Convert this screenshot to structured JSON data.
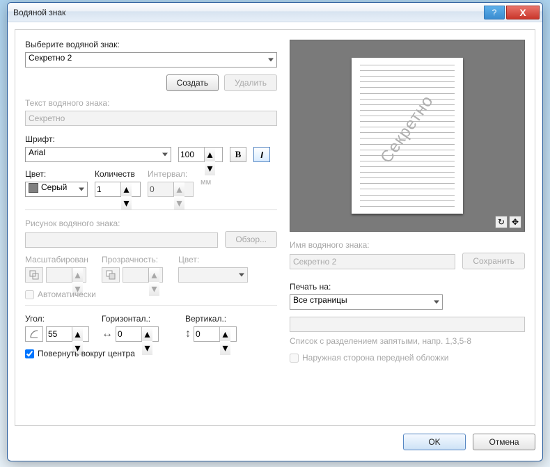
{
  "window": {
    "title": "Водяной знак"
  },
  "select_label": "Выберите водяной знак:",
  "selected_watermark": "Секретно 2",
  "buttons": {
    "create": "Создать",
    "delete": "Удалить",
    "browse": "Обзор...",
    "save": "Сохранить",
    "ok": "OK",
    "cancel": "Отмена"
  },
  "text_section": {
    "label": "Текст водяного знака:",
    "value": "Секретно"
  },
  "font": {
    "label": "Шрифт:",
    "name": "Arial",
    "size": "100",
    "bold_label": "B",
    "italic_label": "I"
  },
  "color": {
    "label": "Цвет:",
    "value": "Серый"
  },
  "count": {
    "label": "Количеств",
    "value": "1"
  },
  "interval": {
    "label": "Интервал:",
    "value": "0",
    "unit": "мм"
  },
  "image_section": {
    "label": "Рисунок водяного знака:",
    "value": ""
  },
  "scale": {
    "label": "Масштабирован"
  },
  "transparency": {
    "label": "Прозрачность:"
  },
  "img_color": {
    "label": "Цвет:"
  },
  "auto_label": "Автоматически",
  "angle": {
    "label": "Угол:",
    "value": "55"
  },
  "horiz": {
    "label": "Горизонтал.:",
    "value": "0"
  },
  "vert": {
    "label": "Вертикал.:",
    "value": "0"
  },
  "rotate_center": "Повернуть вокруг центра",
  "name_label": "Имя водяного знака:",
  "name_value": "Секретно 2",
  "print_label": "Печать на:",
  "print_value": "Все страницы",
  "pages_hint": "Список с разделением запятыми, напр. 1,3,5-8",
  "front_cover": "Наружная сторона передней обложки",
  "pages_value": ""
}
